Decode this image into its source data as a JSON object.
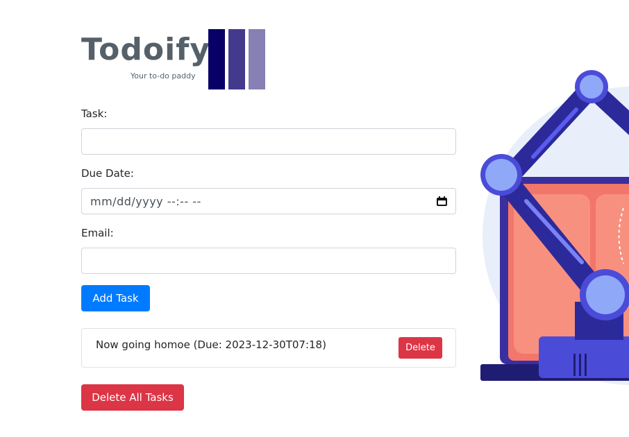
{
  "logo": {
    "title": "Todoify",
    "subtitle": "Your to-do paddy"
  },
  "form": {
    "task_label": "Task:",
    "task_value": "",
    "due_label": "Due Date:",
    "due_placeholder": "mm/dd/yyyy --:-- --",
    "email_label": "Email:",
    "email_value": "",
    "add_button": "Add Task"
  },
  "tasks": [
    {
      "text": "Now going homoe (Due: 2023-12-30T07:18)",
      "delete_label": "Delete"
    }
  ],
  "delete_all_button": "Delete All Tasks",
  "colors": {
    "primary": "#007bff",
    "danger": "#dc3545",
    "logo_text": "#566069",
    "bar_dark": "#080066",
    "bar_mid": "#433a8e",
    "bar_light": "#8680b4",
    "robot_arm": "#2c2a9a",
    "laptop_screen": "#f3766a"
  },
  "icons": {
    "date_picker": "calendar-icon"
  }
}
